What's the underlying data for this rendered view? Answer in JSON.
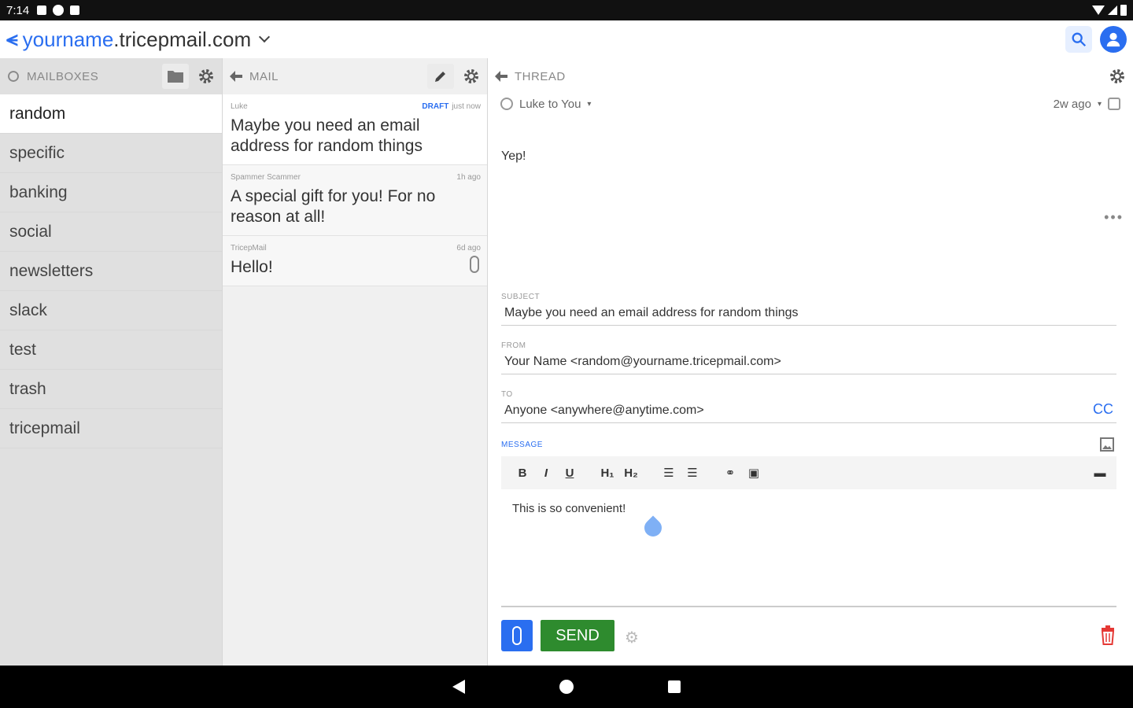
{
  "status": {
    "time": "7:14"
  },
  "header": {
    "user": "yourname",
    "domain": ".tricepmail.com"
  },
  "mailboxes": {
    "title": "MAILBOXES",
    "items": [
      "random",
      "specific",
      "banking",
      "social",
      "newsletters",
      "slack",
      "test",
      "trash",
      "tricepmail"
    ]
  },
  "mail": {
    "title": "MAIL",
    "items": [
      {
        "from": "Luke",
        "draft": "DRAFT",
        "time": "just now",
        "subject": "Maybe you need an email address for random things"
      },
      {
        "from": "Spammer Scammer",
        "time": "1h ago",
        "subject": "A special gift for you! For no reason at all!"
      },
      {
        "from": "TricepMail",
        "time": "6d ago",
        "subject": "Hello!"
      }
    ]
  },
  "thread": {
    "title": "THREAD",
    "from_line": "Luke to You",
    "time": "2w ago",
    "body": "Yep!",
    "subject_label": "SUBJECT",
    "subject": "Maybe you need an email address for random things",
    "from_label": "FROM",
    "from": "Your Name <random@yourname.tricepmail.com>",
    "to_label": "TO",
    "to": "Anyone <anywhere@anytime.com>",
    "cc": "CC",
    "message_label": "MESSAGE",
    "message": "This is so convenient!",
    "send": "SEND"
  },
  "colors": {
    "accent": "#2a6ef0",
    "send": "#2e8b2e",
    "danger": "#e53935"
  }
}
